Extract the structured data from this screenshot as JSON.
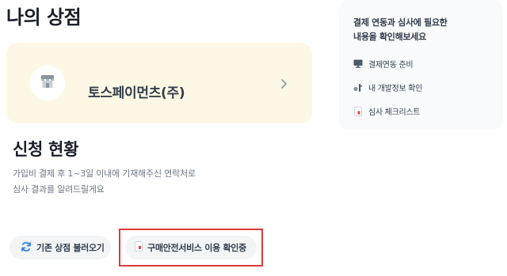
{
  "page": {
    "title": "나의 상점"
  },
  "shop": {
    "name": "토스페이먼츠(주)",
    "icon": "storefront-icon"
  },
  "application": {
    "title": "신청 현황",
    "description": [
      "가입비 결제 후 1~3일 이내에 기재해주신 연락처로",
      "심사 결과를 알려드릴게요"
    ]
  },
  "buttons": {
    "load_shop": {
      "label": "기존 상점 불러오기",
      "icon": "refresh-icon"
    },
    "purchase_safety": {
      "label": "구매안전서비스 이용 확인중",
      "icon": "document-icon"
    }
  },
  "side_panel": {
    "title": [
      "결제 연동과 심사에 필요한",
      "내용을 확인해보세요"
    ],
    "items": [
      {
        "label": "결제연동 준비",
        "icon": "monitor-icon"
      },
      {
        "label": "내 개발정보 확인",
        "icon": "key-icon"
      },
      {
        "label": "심사 체크리스트",
        "icon": "checklist-icon"
      }
    ]
  },
  "colors": {
    "shop_card_bg": "#fdf8e5",
    "button_bg": "#f2f4f6",
    "highlight": "#e03a3a",
    "refresh_icon": "#3182f6"
  }
}
